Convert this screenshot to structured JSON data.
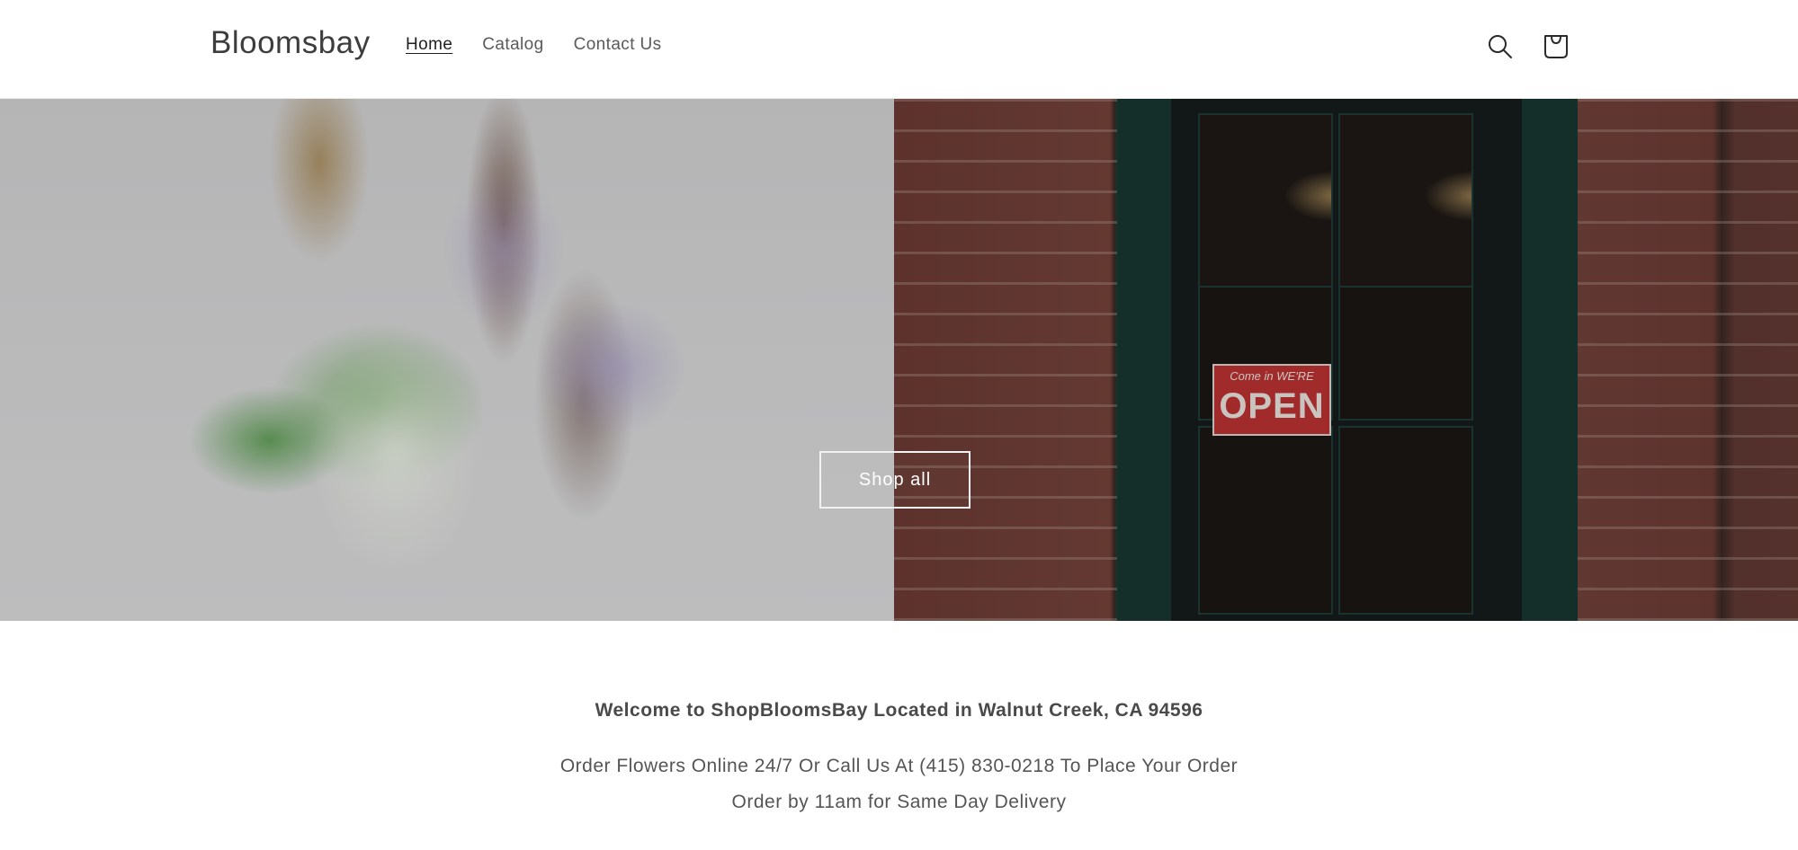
{
  "header": {
    "logo": "Bloomsbay",
    "nav": [
      {
        "label": "Home",
        "active": true
      },
      {
        "label": "Catalog",
        "active": false
      },
      {
        "label": "Contact Us",
        "active": false
      }
    ],
    "icons": {
      "search": "search-icon",
      "cart": "cart-icon"
    }
  },
  "hero": {
    "button_label": "Shop all",
    "sign": {
      "small": "Come in  WE'RE",
      "big": "OPEN"
    }
  },
  "content": {
    "welcome": "Welcome to ShopBloomsBay Located in Walnut Creek, CA 94596",
    "line1": "Order Flowers Online 24/7 Or Call Us At (415) 830-0218 To Place Your Order",
    "line2": "Order by 11am for Same Day Delivery"
  },
  "colors": {
    "text_dark": "#121212",
    "text_muted": "#555555",
    "door_green": "#1b3b34",
    "sign_red": "#b83232"
  }
}
